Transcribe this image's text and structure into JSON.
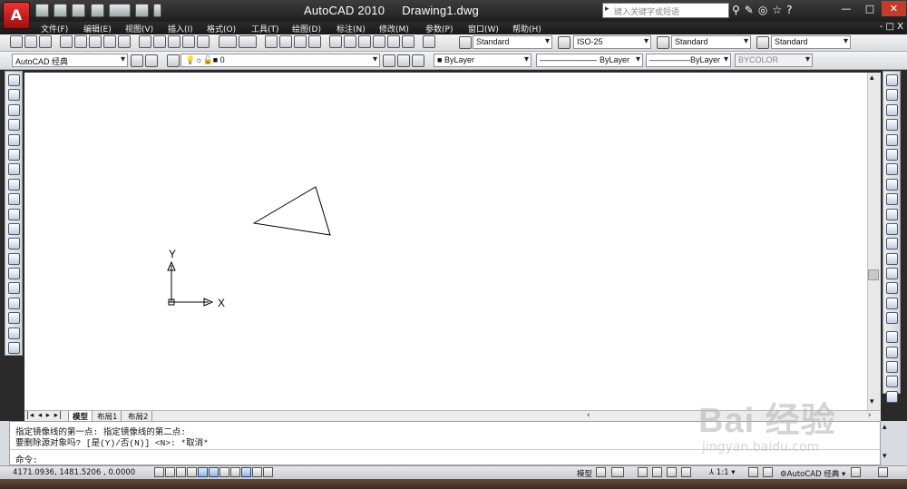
{
  "app": {
    "logo_letter": "A",
    "title": "AutoCAD 2010",
    "document": "Drawing1.dwg",
    "search_placeholder": "键入关键字或短语",
    "mdi_controls": "- □ X"
  },
  "menu": [
    "文件(F)",
    "编辑(E)",
    "视图(V)",
    "插入(I)",
    "格式(O)",
    "工具(T)",
    "绘图(D)",
    "标注(N)",
    "修改(M)",
    "参数(P)",
    "窗口(W)",
    "帮助(H)"
  ],
  "toolbar_styles": {
    "text_style": "Standard",
    "dim_style": "ISO-25",
    "table_style": "Standard",
    "multileader_style": "Standard"
  },
  "toolbar_layers": {
    "workspace": "AutoCAD 经典",
    "layer": "0",
    "color": "ByLayer",
    "linetype": "ByLayer",
    "lineweight": "ByLayer",
    "plot_style": "BYCOLOR"
  },
  "ucs": {
    "x_label": "X",
    "y_label": "Y"
  },
  "layout_tabs": [
    "模型",
    "布局1",
    "布局2"
  ],
  "command": {
    "history": [
      "指定镜像线的第一点: 指定镜像线的第二点:",
      "要删除源对象吗? [是(Y)/否(N)] <N>: *取消*"
    ],
    "prompt": "命令:"
  },
  "status": {
    "coordinates": "4171.0936, 1481.5206 , 0.0000",
    "model_label": "模型",
    "annotation_scale": "1:1",
    "workspace": "AutoCAD 经典"
  },
  "watermark": {
    "line1": "Bai 经验",
    "line2": "jingyan.baidu.com"
  }
}
